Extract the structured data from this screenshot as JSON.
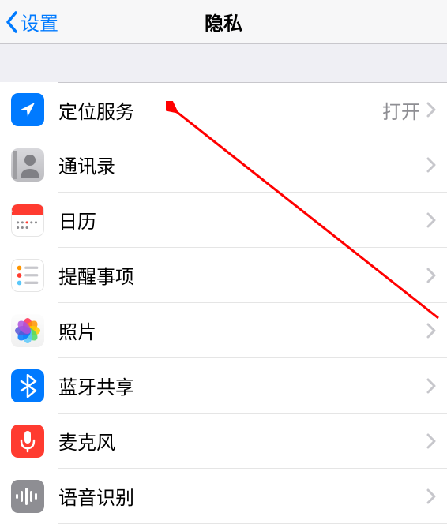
{
  "header": {
    "back_label": "设置",
    "title": "隐私"
  },
  "rows": {
    "location": {
      "label": "定位服务",
      "value": "打开",
      "icon": "location-icon"
    },
    "contacts": {
      "label": "通讯录",
      "icon": "contacts-icon"
    },
    "calendar": {
      "label": "日历",
      "icon": "calendar-icon"
    },
    "reminders": {
      "label": "提醒事项",
      "icon": "reminders-icon"
    },
    "photos": {
      "label": "照片",
      "icon": "photos-icon"
    },
    "bluetooth": {
      "label": "蓝牙共享",
      "icon": "bluetooth-icon"
    },
    "microphone": {
      "label": "麦克风",
      "icon": "microphone-icon"
    },
    "speech": {
      "label": "语音识别",
      "icon": "speech-icon"
    }
  },
  "annotation": {
    "type": "arrow",
    "color": "#ff0000",
    "target": "location-row"
  }
}
